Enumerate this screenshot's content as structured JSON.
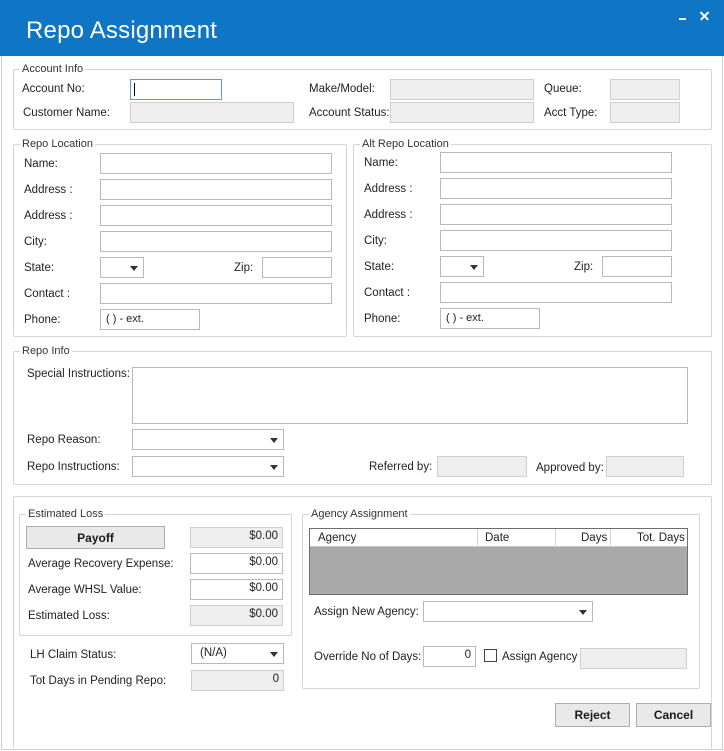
{
  "window": {
    "title": "Repo Assignment"
  },
  "account_info": {
    "title": "Account Info",
    "account_no_label": "Account No:",
    "account_no_value": "",
    "customer_name_label": "Customer Name:",
    "customer_name_value": "",
    "make_model_label": "Make/Model:",
    "make_model_value": "",
    "account_status_label": "Account Status:",
    "account_status_value": "",
    "queue_label": "Queue:",
    "queue_value": "",
    "acct_type_label": "Acct Type:",
    "acct_type_value": ""
  },
  "repo_location": {
    "title": "Repo Location",
    "name_label": "Name:",
    "address1_label": "Address :",
    "address2_label": "Address :",
    "city_label": "City:",
    "state_label": "State:",
    "zip_label": "Zip:",
    "contact_label": "Contact :",
    "phone_label": "Phone:",
    "phone_mask": "(  )   -      ext."
  },
  "alt_repo_location": {
    "title": "Alt Repo Location",
    "name_label": "Name:",
    "address1_label": "Address :",
    "address2_label": "Address :",
    "city_label": "City:",
    "state_label": "State:",
    "zip_label": "Zip:",
    "contact_label": "Contact :",
    "phone_label": "Phone:",
    "phone_mask": "(  )   -      ext."
  },
  "repo_info": {
    "title": "Repo Info",
    "special_instructions_label": "Special Instructions:",
    "repo_reason_label": "Repo Reason:",
    "repo_instructions_label": "Repo Instructions:",
    "referred_by_label": "Referred by:",
    "approved_by_label": "Approved by:"
  },
  "estimated_loss": {
    "title": "Estimated Loss",
    "payoff_button": "Payoff",
    "payoff_value": "$0.00",
    "avg_recovery_label": "Average Recovery Expense:",
    "avg_recovery_value": "$0.00",
    "avg_whsl_label": "Average WHSL Value:",
    "avg_whsl_value": "$0.00",
    "estimated_loss_label": "Estimated Loss:",
    "estimated_loss_value": "$0.00"
  },
  "claim": {
    "lh_claim_status_label": "LH Claim Status:",
    "lh_claim_status_value": "(N/A)",
    "tot_days_label": "Tot Days in Pending Repo:",
    "tot_days_value": "0"
  },
  "agency_assignment": {
    "title": "Agency Assignment",
    "columns": [
      "Agency",
      "Date",
      "Days",
      "Tot. Days"
    ],
    "assign_new_agency_label": "Assign New Agency:",
    "override_days_label": "Override No of Days:",
    "override_days_value": "0",
    "assign_agency_checkbox_label": "Assign Agency"
  },
  "buttons": {
    "reject": "Reject",
    "cancel": "Cancel"
  },
  "colors": {
    "titlebar": "#0f75c5",
    "grid_bg": "#a9a9a9"
  }
}
